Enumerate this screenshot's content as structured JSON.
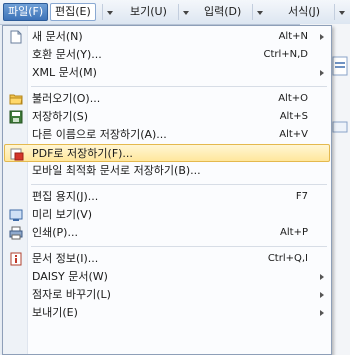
{
  "menubar": {
    "file": "파일(F)",
    "edit": "편집(E)",
    "view": "보기(U)",
    "insert": "입력(D)",
    "format": "서식(J)"
  },
  "menu": {
    "new_doc": {
      "label": "새 문서(N)",
      "shortcut": "Alt+N"
    },
    "compat_doc": {
      "label": "호환 문서(Y)...",
      "shortcut": "Ctrl+N,D"
    },
    "xml_doc": {
      "label": "XML 문서(M)"
    },
    "open": {
      "label": "불러오기(O)...",
      "shortcut": "Alt+O"
    },
    "save": {
      "label": "저장하기(S)",
      "shortcut": "Alt+S"
    },
    "save_as": {
      "label": "다른 이름으로 저장하기(A)...",
      "shortcut": "Alt+V"
    },
    "save_pdf": {
      "label": "PDF로 저장하기(F)..."
    },
    "save_mobile": {
      "label": "모바일 최적화 문서로 저장하기(B)..."
    },
    "page_setup": {
      "label": "편집 용지(J)...",
      "shortcut": "F7"
    },
    "preview": {
      "label": "미리 보기(V)"
    },
    "print": {
      "label": "인쇄(P)...",
      "shortcut": "Alt+P"
    },
    "doc_info": {
      "label": "문서 정보(I)...",
      "shortcut": "Ctrl+Q,I"
    },
    "daisy": {
      "label": "DAISY 문서(W)"
    },
    "braille": {
      "label": "점자로 바꾸기(L)"
    },
    "send": {
      "label": "보내기(E)"
    }
  },
  "colors": {
    "highlight": "#ffe79c",
    "menubar_active": "#3d73b8"
  }
}
